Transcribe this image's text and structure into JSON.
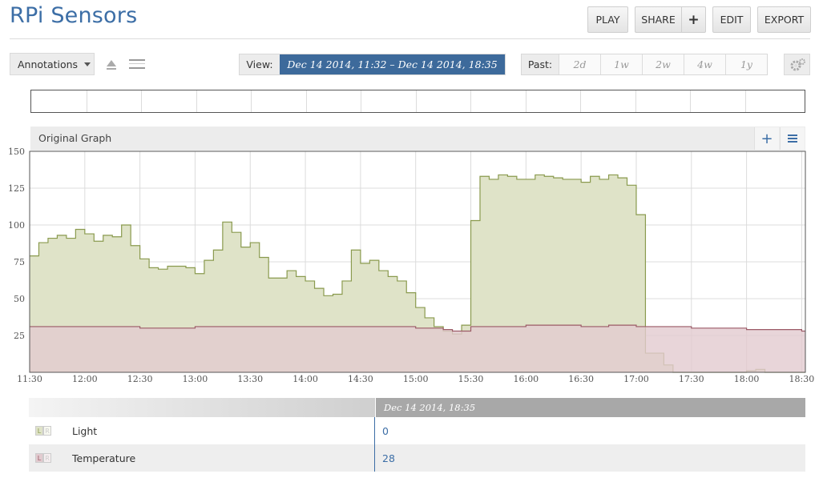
{
  "app": {
    "title": "RPi Sensors"
  },
  "toolbar": {
    "play": "PLAY",
    "share": "SHARE",
    "share_plus": "+",
    "edit": "EDIT",
    "export": "EXPORT"
  },
  "controls": {
    "annotations": "Annotations",
    "view_label": "View:",
    "view_range": "Dec 14 2014, 11:32  –  Dec 14 2014, 18:35",
    "past_label": "Past:",
    "past_options": [
      "2d",
      "1w",
      "2w",
      "4w",
      "1y"
    ]
  },
  "graph": {
    "title": "Original Graph",
    "plus": "+"
  },
  "colors": {
    "light_fill": "#dfe3c8",
    "light_line": "#8a9a4e",
    "temp_fill": "#e2cbd0",
    "temp_line": "#9b5a66",
    "accent": "#3c6ea6"
  },
  "chart_data": {
    "type": "area",
    "xlabel": "",
    "ylabel": "",
    "ylim": [
      0,
      150
    ],
    "yticks": [
      "25",
      "50",
      "75",
      "100",
      "125",
      "150"
    ],
    "xtick_labels": [
      "11:30",
      "12:00",
      "12:30",
      "13:00",
      "13:30",
      "14:00",
      "14:30",
      "15:00",
      "15:30",
      "16:00",
      "16:30",
      "17:00",
      "17:30",
      "18:00",
      "18:30"
    ],
    "grid": true,
    "series": [
      {
        "name": "Light",
        "step": true,
        "x": [
          "11:30",
          "11:35",
          "11:40",
          "11:45",
          "11:50",
          "11:55",
          "12:00",
          "12:05",
          "12:10",
          "12:15",
          "12:20",
          "12:25",
          "12:30",
          "12:35",
          "12:40",
          "12:45",
          "12:50",
          "12:55",
          "13:00",
          "13:05",
          "13:10",
          "13:15",
          "13:20",
          "13:25",
          "13:30",
          "13:35",
          "13:40",
          "13:45",
          "13:50",
          "13:55",
          "14:00",
          "14:05",
          "14:10",
          "14:15",
          "14:20",
          "14:25",
          "14:30",
          "14:35",
          "14:40",
          "14:45",
          "14:50",
          "14:55",
          "15:00",
          "15:05",
          "15:10",
          "15:15",
          "15:20",
          "15:25",
          "15:30",
          "15:35",
          "15:40",
          "15:45",
          "15:50",
          "15:55",
          "16:00",
          "16:05",
          "16:10",
          "16:15",
          "16:20",
          "16:25",
          "16:30",
          "16:35",
          "16:40",
          "16:45",
          "16:50",
          "16:55",
          "17:00",
          "17:05",
          "17:10",
          "17:15",
          "17:20",
          "17:25",
          "17:30",
          "17:35",
          "17:40",
          "17:45",
          "17:50",
          "17:55",
          "18:00",
          "18:05",
          "18:10",
          "18:15",
          "18:20",
          "18:25",
          "18:30",
          "18:35"
        ],
        "values": [
          79,
          88,
          91,
          93,
          91,
          97,
          94,
          89,
          93,
          92,
          100,
          86,
          77,
          71,
          70,
          72,
          72,
          71,
          67,
          76,
          83,
          102,
          95,
          85,
          88,
          78,
          64,
          64,
          69,
          65,
          62,
          57,
          52,
          53,
          62,
          83,
          74,
          76,
          69,
          65,
          62,
          54,
          44,
          37,
          31,
          28,
          26,
          32,
          103,
          133,
          131,
          134,
          133,
          131,
          131,
          134,
          133,
          132,
          131,
          131,
          129,
          133,
          131,
          134,
          132,
          127,
          107,
          13,
          13,
          5,
          0,
          0,
          0,
          0,
          0,
          0,
          0,
          0,
          1,
          2,
          0,
          0,
          0,
          0,
          0,
          0
        ],
        "latest": "0"
      },
      {
        "name": "Temperature",
        "step": true,
        "x": [
          "11:30",
          "12:00",
          "12:30",
          "13:00",
          "13:30",
          "14:00",
          "14:30",
          "15:00",
          "15:15",
          "15:20",
          "15:30",
          "16:00",
          "16:30",
          "16:45",
          "17:00",
          "17:30",
          "18:00",
          "18:30",
          "18:35"
        ],
        "values": [
          31,
          31,
          30,
          31,
          31,
          31,
          31,
          30,
          29,
          28,
          31,
          32,
          31,
          32,
          31,
          30,
          29,
          28,
          28
        ],
        "latest": "28"
      }
    ]
  },
  "legend": {
    "timestamp": "Dec 14 2014, 18:35",
    "lr_left": "L",
    "lr_right": "R",
    "rows": [
      {
        "name": "Light",
        "value": "0"
      },
      {
        "name": "Temperature",
        "value": "28"
      }
    ]
  }
}
